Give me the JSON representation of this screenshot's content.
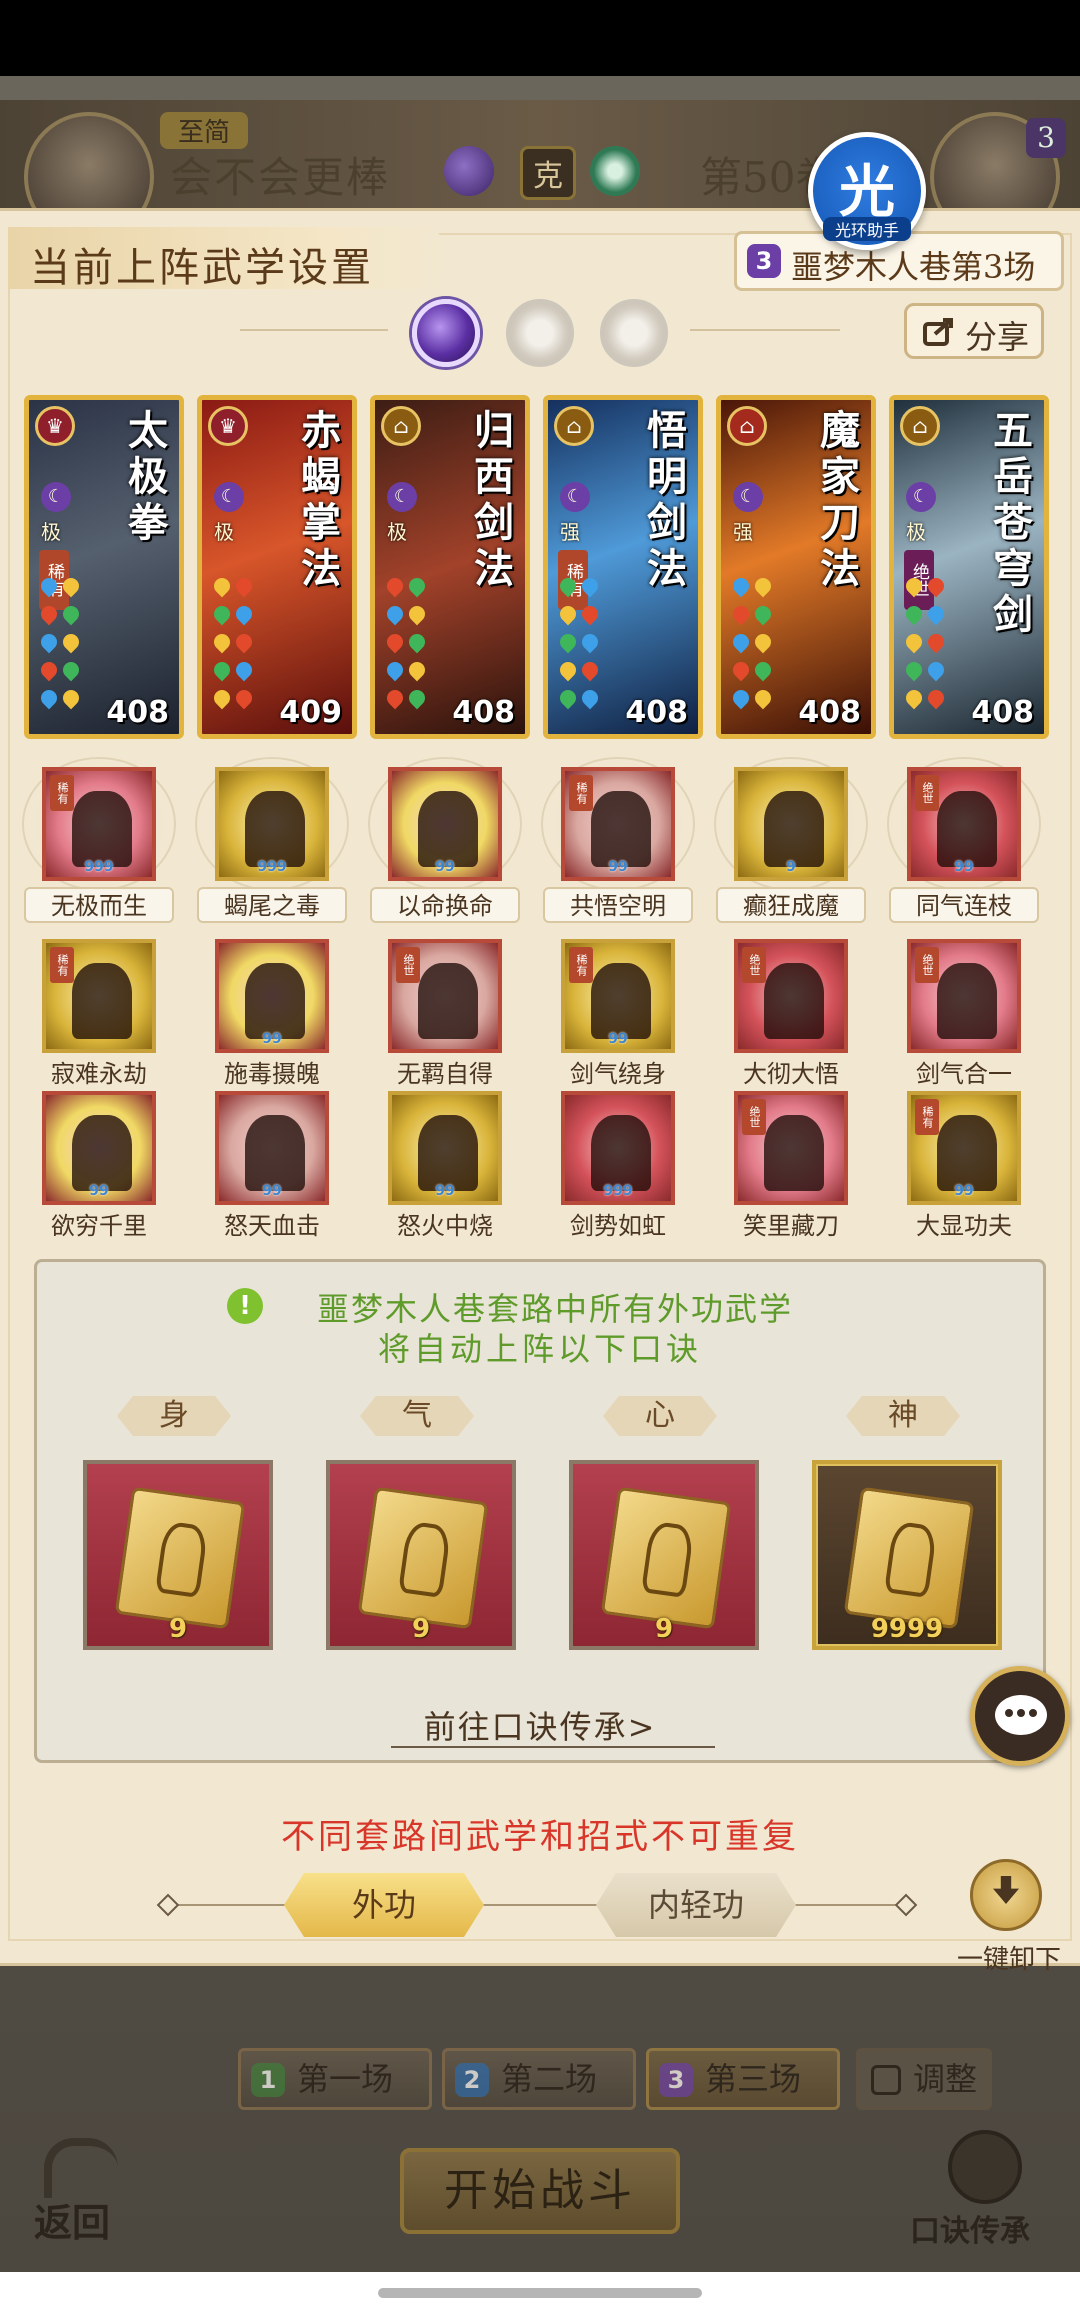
{
  "background": {
    "player_tag": "至简",
    "player_name": "会不会更棒",
    "vs_label": "克",
    "opponent_round": "第50卷"
  },
  "helper": {
    "glyph": "光",
    "label": "光环助手"
  },
  "panel": {
    "title": "当前上阵武学设置",
    "round_badge": "3",
    "round_label": "噩梦木人巷第3场",
    "share_label": "分享"
  },
  "cards": [
    {
      "name": "太极拳",
      "grade": "极",
      "rarity": "稀有",
      "power": "408",
      "palette": "dark"
    },
    {
      "name": "赤蝎掌法",
      "grade": "极",
      "rarity": "",
      "power": "409",
      "palette": "red"
    },
    {
      "name": "归西剑法",
      "grade": "极",
      "rarity": "",
      "power": "408",
      "palette": "brown"
    },
    {
      "name": "悟明剑法",
      "grade": "强",
      "rarity": "稀有",
      "power": "408",
      "palette": "blue"
    },
    {
      "name": "魔家刀法",
      "grade": "强",
      "rarity": "",
      "power": "408",
      "palette": "orange"
    },
    {
      "name": "五岳苍穹剑",
      "grade": "极",
      "rarity": "绝世",
      "power": "408",
      "palette": "steel"
    }
  ],
  "moves_row1": [
    {
      "label": "无极而生",
      "tag": "稀有",
      "dots": "999"
    },
    {
      "label": "蝎尾之毒",
      "tag": "",
      "dots": "999"
    },
    {
      "label": "以命换命",
      "tag": "",
      "dots": "99"
    },
    {
      "label": "共悟空明",
      "tag": "稀有",
      "dots": "99"
    },
    {
      "label": "癫狂成魔",
      "tag": "",
      "dots": "9"
    },
    {
      "label": "同气连枝",
      "tag": "绝世",
      "dots": "99"
    }
  ],
  "moves_row2": [
    {
      "label": "寂难永劫",
      "tag": "稀有",
      "dots": ""
    },
    {
      "label": "施毒摄魄",
      "tag": "",
      "dots": "99"
    },
    {
      "label": "无羁自得",
      "tag": "绝世",
      "dots": ""
    },
    {
      "label": "剑气绕身",
      "tag": "稀有",
      "dots": "99"
    },
    {
      "label": "大彻大悟",
      "tag": "绝世",
      "dots": ""
    },
    {
      "label": "剑气合一",
      "tag": "绝世",
      "dots": ""
    }
  ],
  "moves_row3": [
    {
      "label": "欲穷千里",
      "tag": "",
      "dots": "99"
    },
    {
      "label": "怒天血击",
      "tag": "",
      "dots": "99"
    },
    {
      "label": "怒火中烧",
      "tag": "",
      "dots": "99"
    },
    {
      "label": "剑势如虹",
      "tag": "",
      "dots": "999"
    },
    {
      "label": "笑里藏刀",
      "tag": "绝世",
      "dots": ""
    },
    {
      "label": "大显功夫",
      "tag": "稀有",
      "dots": "99"
    }
  ],
  "mantra": {
    "notice_line1": "噩梦木人巷套路中所有外功武学",
    "notice_line2": "将自动上阵以下口诀",
    "slots": [
      {
        "label": "身",
        "level": "9"
      },
      {
        "label": "气",
        "level": "9"
      },
      {
        "label": "心",
        "level": "9"
      },
      {
        "label": "神",
        "level": "9999"
      }
    ],
    "goto_label": "前往口诀传承>"
  },
  "warning": "不同套路间武学和招式不可重复",
  "tabs": {
    "external": "外功",
    "internal": "内轻功"
  },
  "unload_label": "一键卸下",
  "rounds": [
    {
      "num": "1",
      "label": "第一场"
    },
    {
      "num": "2",
      "label": "第二场"
    },
    {
      "num": "3",
      "label": "第三场"
    }
  ],
  "adjust_label": "调整",
  "start_label": "开始战斗",
  "back_label": "返回",
  "mantra_inherit_label": "口诀传承"
}
